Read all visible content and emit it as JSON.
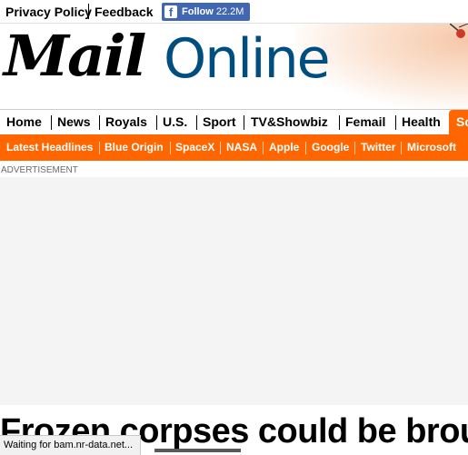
{
  "topbar": {
    "privacy": "Privacy Policy",
    "feedback": "Feedback",
    "fb_follow": "Follow",
    "fb_count": "22.2M",
    "fb_icon": "facebook-icon"
  },
  "logo": {
    "mail": "Mail",
    "online": "Online"
  },
  "nav_primary": [
    "Home",
    "News",
    "Royals",
    "U.S.",
    "Sport",
    "TV&Showbiz",
    "Femail",
    "Health",
    "Sc"
  ],
  "nav_secondary": [
    "Latest Headlines",
    "Blue Origin",
    "SpaceX",
    "NASA",
    "Apple",
    "Google",
    "Twitter",
    "Microsoft"
  ],
  "advertisement_label": "ADVERTISEMENT",
  "headline": "Frozen corpses could be brought",
  "status_bar": "Waiting for bam.nr-data.net...",
  "colors": {
    "brand_orange": "#ff6600",
    "facebook_blue": "#4267b2",
    "online_blue": "#004d80"
  }
}
